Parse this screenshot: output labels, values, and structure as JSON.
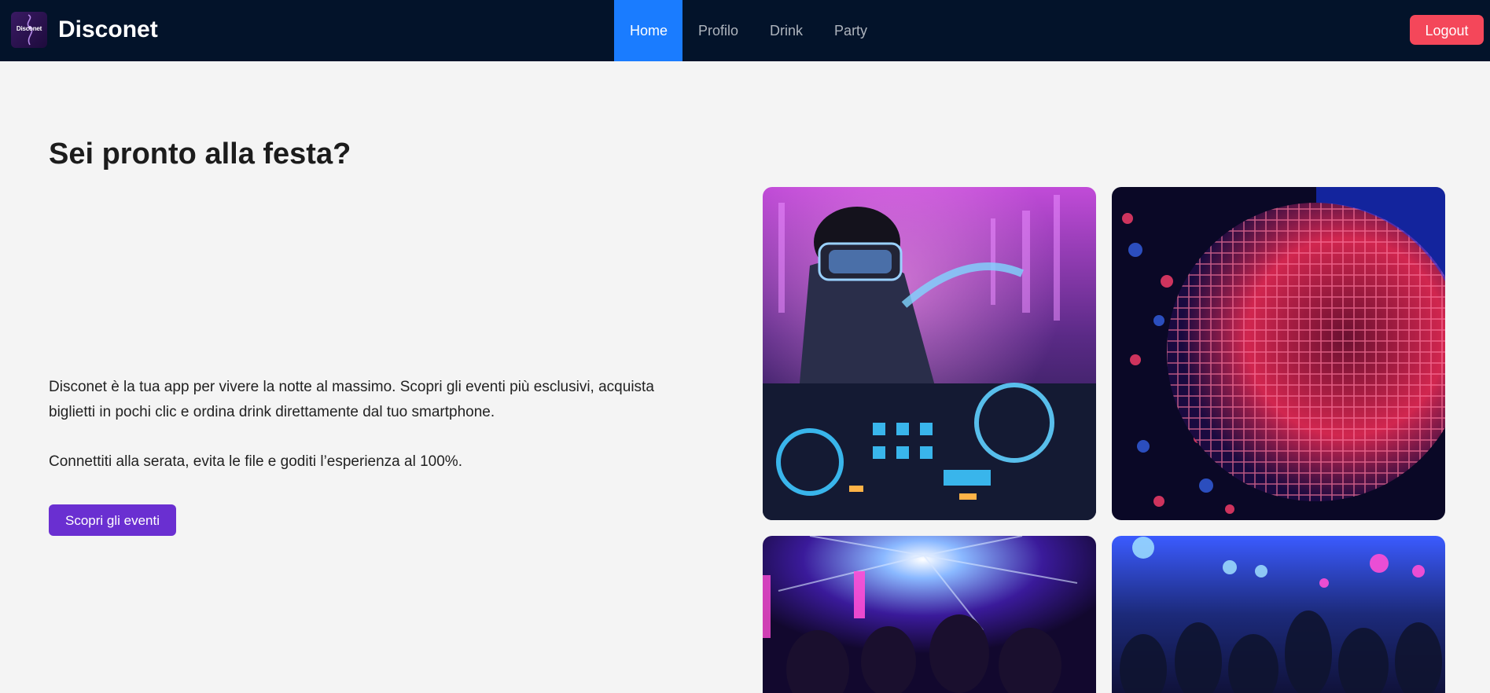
{
  "brand": {
    "logo_text": "Disconet",
    "name": "Disconet"
  },
  "nav": {
    "items": [
      {
        "label": "Home",
        "active": true
      },
      {
        "label": "Profilo",
        "active": false
      },
      {
        "label": "Drink",
        "active": false
      },
      {
        "label": "Party",
        "active": false
      }
    ],
    "logout_label": "Logout"
  },
  "hero": {
    "title": "Sei pronto alla festa?",
    "paragraph_1": "Disconet è la tua app per vivere la notte al massimo. Scopri gli eventi più esclusivi, acquista biglietti in pochi clic e ordina drink direttamente dal tuo smartphone.",
    "paragraph_2": "Connettiti alla serata, evita le file e goditi l’esperienza al 100%.",
    "cta_label": "Scopri gli eventi"
  },
  "gallery": {
    "images": [
      {
        "icon": "dj-vr-photo"
      },
      {
        "icon": "disco-ball-photo"
      },
      {
        "icon": "club-crowd-lights-photo"
      },
      {
        "icon": "party-crowd-photo"
      }
    ]
  },
  "colors": {
    "navbar_bg": "#03132a",
    "nav_active": "#1a7cff",
    "logout": "#f4475a",
    "cta": "#6a2fd1",
    "page_bg": "#f4f4f4"
  }
}
